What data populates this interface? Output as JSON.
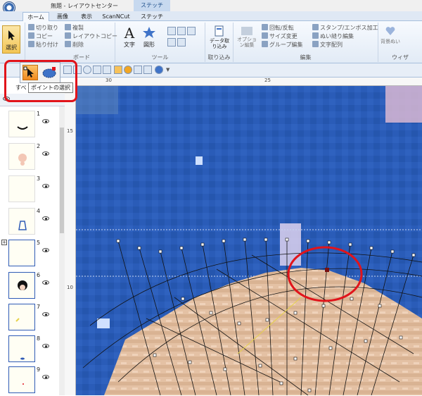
{
  "window": {
    "title": "無題 - レイアウトセンター",
    "context_tab": "ステッチ"
  },
  "tabs": [
    "ホーム",
    "画像",
    "表示",
    "ScanNCut",
    "ステッチ"
  ],
  "ribbon": {
    "select_label": "選択",
    "clipboard": {
      "cut": "切り取り",
      "copy": "コピー",
      "paste": "貼り付け",
      "duplicate": "複製",
      "layout_copy": "レイアウトコピー",
      "delete": "削除",
      "group_label": "ボード"
    },
    "tools": {
      "text": "文字",
      "shape": "図形",
      "group_label": "ツール"
    },
    "import": {
      "data_import": "データ取り込み",
      "group_label": "取り込み"
    },
    "edit": {
      "options": "オプション編集",
      "rotate": "回転/反転",
      "resize": "サイズ変更",
      "group_edit": "グループ編集",
      "stamp": "スタンプ/エンボス加工",
      "stitch_order": "ぬい縫り編集",
      "char_array": "文字配列",
      "group_label": "編集"
    },
    "wizard": {
      "bg_sew": "背景ぬい",
      "group_label": "ウィザ"
    },
    "select_group_label": "選択"
  },
  "popup": {
    "tooltip": "ポイントの選択",
    "partial_label": "すべ"
  },
  "ruler": {
    "top_marks": [
      "30",
      "25"
    ],
    "left_marks": [
      "15",
      "10"
    ]
  },
  "layers": [
    {
      "num": "1"
    },
    {
      "num": "2"
    },
    {
      "num": "3"
    },
    {
      "num": "4"
    },
    {
      "num": "5"
    },
    {
      "num": "6"
    },
    {
      "num": "7"
    },
    {
      "num": "8"
    },
    {
      "num": "9"
    }
  ],
  "colors": {
    "accent": "#e1141b",
    "sky": "#2f5bb6",
    "sand": "#e6c2a3",
    "ribbon": "#dfe8f4"
  }
}
